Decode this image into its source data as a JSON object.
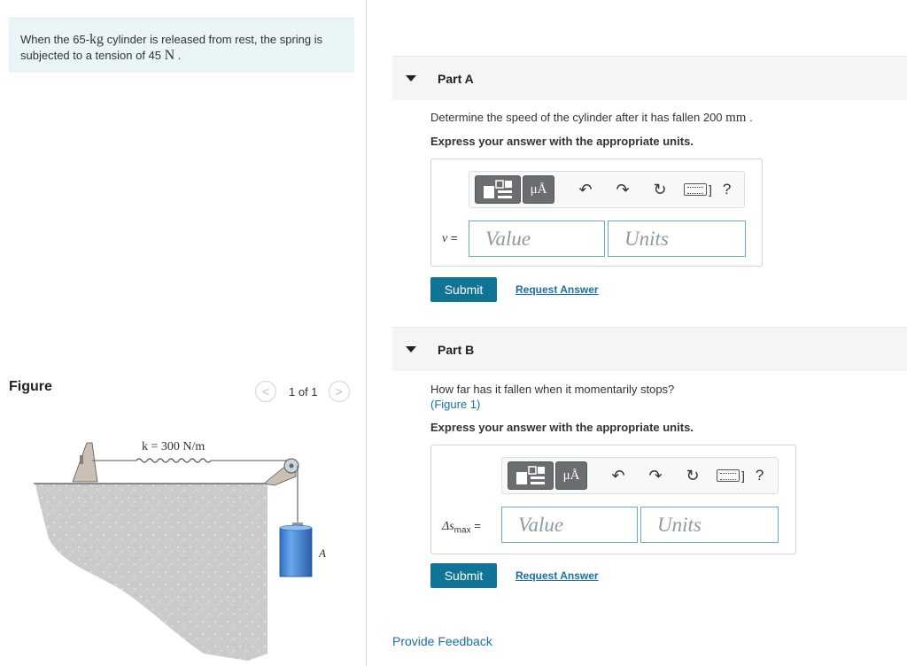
{
  "problem": {
    "text_prefix": "When the 65-",
    "mass_unit": "kg",
    "text_middle": " cylinder is released from rest, the spring is subjected to a tension of 45 ",
    "force_unit": "N",
    "text_suffix": " ."
  },
  "figure": {
    "label": "Figure",
    "pager": "1 of 1",
    "prev": "<",
    "next": ">",
    "spring_label": "k = 300 N/m",
    "point_label": "A"
  },
  "partA": {
    "title": "Part A",
    "question_prefix": "Determine the speed of the cylinder after it has fallen 200 ",
    "question_unit": "mm",
    "question_suffix": " .",
    "instruction": "Express your answer with the appropriate units.",
    "variable": "v",
    "equals": " =",
    "value_placeholder": "Value",
    "units_placeholder": "Units",
    "submit": "Submit",
    "request": "Request Answer"
  },
  "partB": {
    "title": "Part B",
    "question": "How far has it fallen when it momentarily stops?",
    "figure_link_open": "(",
    "figure_link": "Figure 1",
    "figure_link_close": ")",
    "instruction": "Express your answer with the appropriate units.",
    "variable": "Δs",
    "variable_sub": "max",
    "equals": " =",
    "value_placeholder": "Value",
    "units_placeholder": "Units",
    "submit": "Submit",
    "request": "Request Answer"
  },
  "toolbar": {
    "units_symbol": "μÅ",
    "undo": "↶",
    "redo": "↷",
    "reset": "↻",
    "bracket": "]",
    "help": "?"
  },
  "feedback": "Provide Feedback"
}
